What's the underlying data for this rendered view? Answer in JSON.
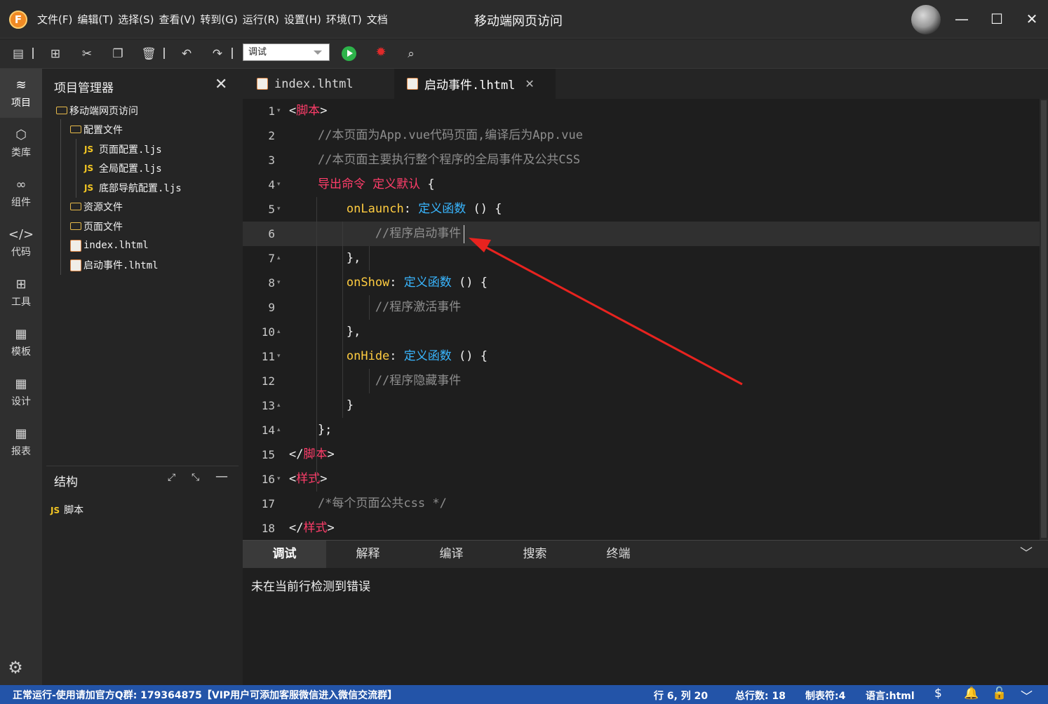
{
  "window": {
    "logo_letter": "F",
    "title": "移动端网页访问",
    "menu": [
      "文件(F)",
      "编辑(T)",
      "选择(S)",
      "查看(V)",
      "转到(G)",
      "运行(R)",
      "设置(H)",
      "环境(T)",
      "文档"
    ],
    "controls": {
      "minimize": "—",
      "maximize": "☐",
      "close": "✕"
    }
  },
  "toolbar": {
    "mode_value": "调试",
    "icons": [
      "save-icon",
      "new-file-icon",
      "cut-icon",
      "copy-icon",
      "delete-icon",
      "undo-icon",
      "redo-icon",
      "run-icon",
      "debug-icon",
      "preview-icon"
    ]
  },
  "activity": [
    {
      "label": "项目",
      "icon": "layers-icon",
      "glyph": "≋"
    },
    {
      "label": "类库",
      "icon": "cube-icon",
      "glyph": "⬡"
    },
    {
      "label": "组件",
      "icon": "link-icon",
      "glyph": "∞"
    },
    {
      "label": "代码",
      "icon": "code-icon",
      "glyph": "</>"
    },
    {
      "label": "工具",
      "icon": "grid-icon",
      "glyph": "⊞"
    },
    {
      "label": "模板",
      "icon": "template-icon",
      "glyph": "▦"
    },
    {
      "label": "设计",
      "icon": "design-icon",
      "glyph": "▦"
    },
    {
      "label": "报表",
      "icon": "report-icon",
      "glyph": "▦"
    }
  ],
  "explorer": {
    "title": "项目管理器",
    "tree": [
      {
        "label": "移动端网页访问",
        "type": "folder"
      },
      {
        "label": "配置文件",
        "type": "folder"
      },
      {
        "label": "页面配置.ljs",
        "type": "js"
      },
      {
        "label": "全局配置.ljs",
        "type": "js"
      },
      {
        "label": "底部导航配置.ljs",
        "type": "js"
      },
      {
        "label": "资源文件",
        "type": "folder"
      },
      {
        "label": "页面文件",
        "type": "folder"
      },
      {
        "label": "index.lhtml",
        "type": "html"
      },
      {
        "label": "启动事件.lhtml",
        "type": "html"
      }
    ],
    "js_badge": "JS"
  },
  "structure": {
    "title": "结构",
    "item": "脚本",
    "badge": "JS"
  },
  "tabs": [
    {
      "label": "index.lhtml",
      "active": false
    },
    {
      "label": "启动事件.lhtml",
      "active": true
    }
  ],
  "editor": {
    "current_line": 6,
    "lines": [
      {
        "n": "1",
        "fold": "▾",
        "tokens": [
          [
            "k-white",
            "<"
          ],
          [
            "k-red",
            "脚本"
          ],
          [
            "k-white",
            ">"
          ]
        ]
      },
      {
        "n": "2",
        "fold": "",
        "tokens": [
          [
            "k-cmt",
            "    //本页面为App.vue代码页面,编译后为App.vue"
          ]
        ]
      },
      {
        "n": "3",
        "fold": "",
        "tokens": [
          [
            "k-cmt",
            "    //本页面主要执行整个程序的全局事件及公共CSS"
          ]
        ]
      },
      {
        "n": "4",
        "fold": "▾",
        "tokens": [
          [
            "k-red",
            "    导出命令 定义默认"
          ],
          [
            "k-white",
            " {"
          ]
        ]
      },
      {
        "n": "5",
        "fold": "▾",
        "tokens": [
          [
            "k-yellow",
            "        onLaunch"
          ],
          [
            "k-white",
            ": "
          ],
          [
            "k-blue",
            "定义函数"
          ],
          [
            "k-white",
            " () {"
          ]
        ]
      },
      {
        "n": "6",
        "fold": "",
        "tokens": [
          [
            "k-cmt",
            "            //程序启动事件"
          ]
        ]
      },
      {
        "n": "7",
        "fold": "▴",
        "tokens": [
          [
            "k-white",
            "        },"
          ]
        ]
      },
      {
        "n": "8",
        "fold": "▾",
        "tokens": [
          [
            "k-yellow",
            "        onShow"
          ],
          [
            "k-white",
            ": "
          ],
          [
            "k-blue",
            "定义函数"
          ],
          [
            "k-white",
            " () {"
          ]
        ]
      },
      {
        "n": "9",
        "fold": "",
        "tokens": [
          [
            "k-cmt",
            "            //程序激活事件"
          ]
        ]
      },
      {
        "n": "10",
        "fold": "▴",
        "tokens": [
          [
            "k-white",
            "        },"
          ]
        ]
      },
      {
        "n": "11",
        "fold": "▾",
        "tokens": [
          [
            "k-yellow",
            "        onHide"
          ],
          [
            "k-white",
            ": "
          ],
          [
            "k-blue",
            "定义函数"
          ],
          [
            "k-white",
            " () {"
          ]
        ]
      },
      {
        "n": "12",
        "fold": "",
        "tokens": [
          [
            "k-cmt",
            "            //程序隐藏事件"
          ]
        ]
      },
      {
        "n": "13",
        "fold": "▴",
        "tokens": [
          [
            "k-white",
            "        }"
          ]
        ]
      },
      {
        "n": "14",
        "fold": "▴",
        "tokens": [
          [
            "k-white",
            "    };"
          ]
        ]
      },
      {
        "n": "15",
        "fold": "",
        "tokens": [
          [
            "k-white",
            "</"
          ],
          [
            "k-red",
            "脚本"
          ],
          [
            "k-white",
            ">"
          ]
        ]
      },
      {
        "n": "16",
        "fold": "▾",
        "tokens": [
          [
            "k-white",
            "<"
          ],
          [
            "k-red",
            "样式"
          ],
          [
            "k-white",
            ">"
          ]
        ]
      },
      {
        "n": "17",
        "fold": "",
        "tokens": [
          [
            "k-cmt",
            "    /*每个页面公共css */"
          ]
        ]
      },
      {
        "n": "18",
        "fold": "",
        "tokens": [
          [
            "k-white",
            "</"
          ],
          [
            "k-red",
            "样式"
          ],
          [
            "k-white",
            ">"
          ]
        ]
      }
    ]
  },
  "panel": {
    "tabs": [
      "调试",
      "解释",
      "编译",
      "搜索",
      "终端"
    ],
    "active_tab": "调试",
    "message": "未在当前行检测到错误"
  },
  "status": {
    "left": "正常运行-使用请加官方Q群: 179364875【VIP用户可添加客服微信进入微信交流群】",
    "position": "行 6, 列 20",
    "total_lines": "总行数: 18",
    "tab_size": "制表符:4",
    "language": "语言:html",
    "accent": "#2354a8"
  }
}
